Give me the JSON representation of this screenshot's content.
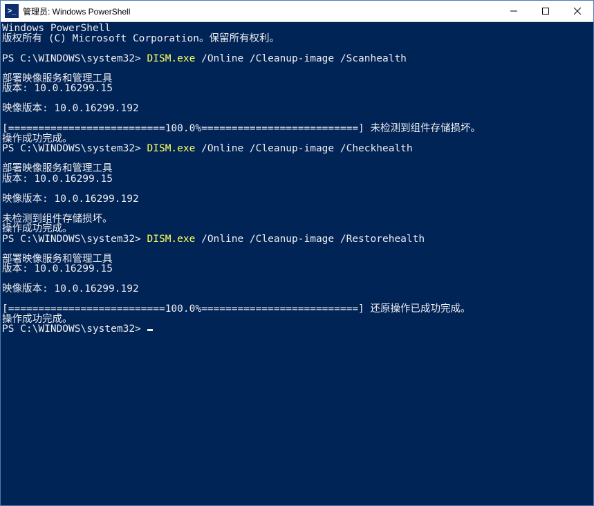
{
  "window": {
    "title": "管理员: Windows PowerShell",
    "icon_glyph": ">_"
  },
  "header": {
    "app_name": "Windows PowerShell",
    "copyright": "版权所有 (C) Microsoft Corporation。保留所有权利。"
  },
  "blocks": [
    {
      "prompt": "PS C:\\WINDOWS\\system32> ",
      "cmd_head": "DISM.exe",
      "cmd_tail": " /Online /Cleanup-image /Scanhealth",
      "tool_line": "部署映像服务和管理工具",
      "version_line": "版本: 10.0.16299.15",
      "image_version_line": "映像版本: 10.0.16299.192",
      "extra_line": "",
      "progress_line": "[==========================100.0%==========================] 未检测到组件存储损坏。",
      "done_line": "操作成功完成。"
    },
    {
      "prompt": "PS C:\\WINDOWS\\system32> ",
      "cmd_head": "DISM.exe",
      "cmd_tail": " /Online /Cleanup-image /Checkhealth",
      "tool_line": "部署映像服务和管理工具",
      "version_line": "版本: 10.0.16299.15",
      "image_version_line": "映像版本: 10.0.16299.192",
      "extra_line": "未检测到组件存储损坏。",
      "progress_line": "",
      "done_line": "操作成功完成。"
    },
    {
      "prompt": "PS C:\\WINDOWS\\system32> ",
      "cmd_head": "DISM.exe",
      "cmd_tail": " /Online /Cleanup-image /Restorehealth",
      "tool_line": "部署映像服务和管理工具",
      "version_line": "版本: 10.0.16299.15",
      "image_version_line": "映像版本: 10.0.16299.192",
      "extra_line": "",
      "progress_line": "[==========================100.0%==========================] 还原操作已成功完成。",
      "done_line": "操作成功完成。"
    }
  ],
  "final_prompt": "PS C:\\WINDOWS\\system32> "
}
